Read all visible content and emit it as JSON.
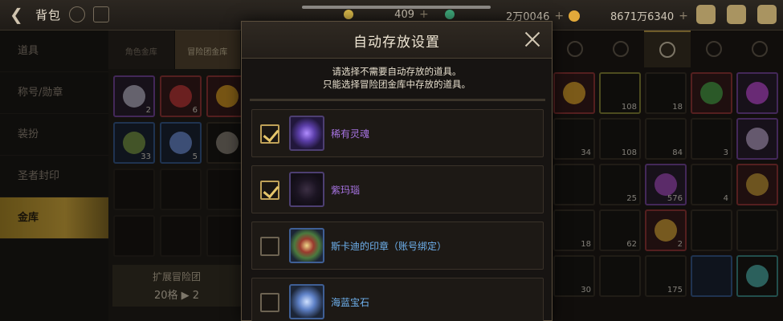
{
  "topbar": {
    "title": "背包",
    "currencies": [
      {
        "value": "409",
        "color": "#d8b84a"
      },
      {
        "value": "2万0046",
        "color": "#e2a93a"
      },
      {
        "value": "8671万6340",
        "color": "#e2b84a"
      }
    ]
  },
  "sidebar": {
    "items": [
      {
        "label": "道具"
      },
      {
        "label": "称号/勋章"
      },
      {
        "label": "装扮"
      },
      {
        "label": "圣者封印"
      },
      {
        "label": "金库"
      }
    ]
  },
  "vault": {
    "tabs": [
      "角色金库",
      "冒险团金库"
    ],
    "slots": [
      {
        "count": "2",
        "color": "#b9b3c7"
      },
      {
        "count": "6",
        "color": "#c43b3b"
      },
      {
        "count": "",
        "color": "#d99b25"
      },
      {
        "count": "33",
        "color": "#7b9a4a"
      },
      {
        "count": "5",
        "color": "#6e8fd6"
      },
      {
        "count": "",
        "color": "#8a8378"
      }
    ],
    "expand_title": "扩展冒险团",
    "expand_sub": "20格 ▶ 2"
  },
  "inventory": {
    "counts": [
      "",
      "108",
      "18",
      "",
      "",
      "34",
      "108",
      "84",
      "3",
      "",
      "",
      "25",
      "576",
      "4",
      "",
      "18",
      "62",
      "2",
      "",
      "",
      "30",
      "",
      "175",
      "",
      ""
    ]
  },
  "modal": {
    "title": "自动存放设置",
    "notice_line1": "请选择不需要自动存放的道具。",
    "notice_line2": "只能选择冒险团金库中存放的道具。",
    "items": [
      {
        "name": "稀有灵魂",
        "checked": true,
        "color": "purple"
      },
      {
        "name": "紫玛瑙",
        "checked": true,
        "color": "purple"
      },
      {
        "name": "斯卡迪的印章（账号绑定）",
        "checked": false,
        "color": "blue"
      },
      {
        "name": "海蓝宝石",
        "checked": false,
        "color": "blue"
      }
    ]
  }
}
